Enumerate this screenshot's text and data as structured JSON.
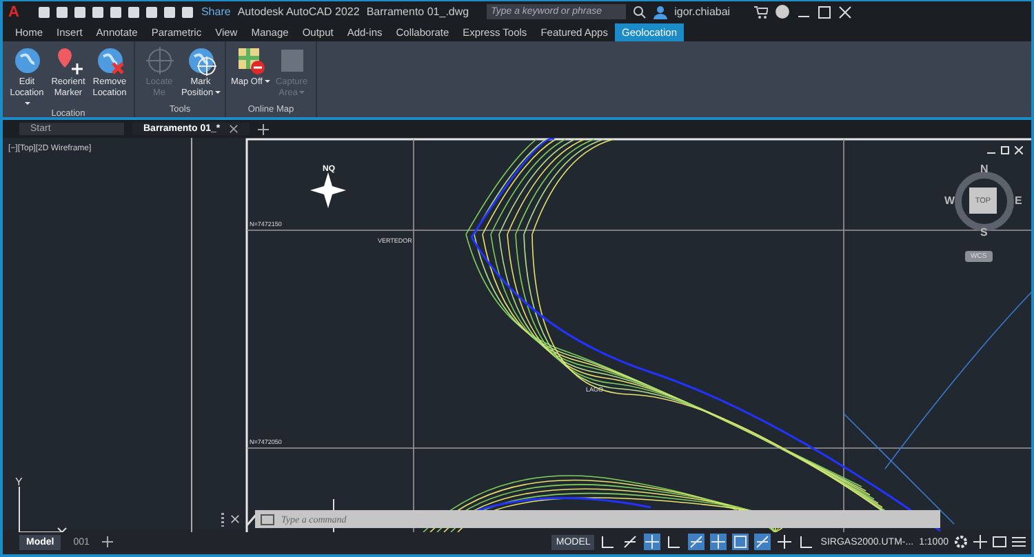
{
  "title_bar": {
    "logo": "A",
    "title": "Autodesk AutoCAD 2022",
    "file": "Barramento 01_.dwg",
    "share": "Share",
    "search": {
      "placeholder": "Type a keyword or phrase"
    },
    "user": "igor.chiabai"
  },
  "ribbon_tabs": [
    {
      "label": "Home",
      "selected": false
    },
    {
      "label": "Insert",
      "selected": false
    },
    {
      "label": "Annotate",
      "selected": false
    },
    {
      "label": "Parametric",
      "selected": false
    },
    {
      "label": "View",
      "selected": false
    },
    {
      "label": "Manage",
      "selected": false
    },
    {
      "label": "Output",
      "selected": false
    },
    {
      "label": "Add-ins",
      "selected": false
    },
    {
      "label": "Collaborate",
      "selected": false
    },
    {
      "label": "Express Tools",
      "selected": false
    },
    {
      "label": "Featured Apps",
      "selected": false
    },
    {
      "label": "Geolocation",
      "selected": true
    }
  ],
  "ribbon_panels": [
    {
      "title": "Location",
      "tools": [
        {
          "kind": "globe",
          "label": "Edit Location",
          "disabled": false,
          "dropdown": true
        },
        {
          "kind": "marker",
          "label": "Reorient Marker",
          "disabled": false,
          "dropdown": false
        },
        {
          "kind": "remove",
          "label": "Remove Location",
          "disabled": false,
          "dropdown": false
        }
      ]
    },
    {
      "title": "Tools",
      "tools": [
        {
          "kind": "locate",
          "label": "Locate Me",
          "disabled": true,
          "dropdown": false
        },
        {
          "kind": "mark",
          "label": "Mark Position",
          "disabled": false,
          "dropdown": true
        }
      ]
    },
    {
      "title": "Online Map",
      "tools": [
        {
          "kind": "map",
          "label": "Map Off",
          "disabled": false,
          "dropdown": true
        },
        {
          "kind": "capture",
          "label": "Capture Area",
          "disabled": true,
          "dropdown": true
        }
      ]
    }
  ],
  "file_tabs": [
    {
      "label": "Start",
      "selected": false
    },
    {
      "label": "Barramento 01_*",
      "selected": true
    }
  ],
  "viewport_label": "[−][Top][2D Wireframe]",
  "viewcube": {
    "north": "N",
    "south": "S",
    "east": "E",
    "west": "W",
    "face": "TOP",
    "ucs": "WCS"
  },
  "map_labels": [
    {
      "text": "NQ",
      "kind": "compass"
    },
    {
      "text": "N=7472150",
      "kind": "grid"
    },
    {
      "text": "VERTEDOR",
      "kind": "site"
    },
    {
      "text": "LAGO",
      "kind": "site"
    },
    {
      "text": "N=7472050",
      "kind": "grid"
    }
  ],
  "ucs_label": "Y",
  "command_line": {
    "placeholder": "Type a command"
  },
  "layout_tabs": [
    {
      "label": "Model",
      "selected": true
    },
    {
      "label": "001",
      "selected": false
    }
  ],
  "status_bar": {
    "space": "MODEL",
    "coordinate_system": "SIRGAS2000.UTM-...",
    "scale": "1:1000",
    "toggles": [
      {
        "kind": "grid",
        "on": false
      },
      {
        "kind": "ortho",
        "on": false
      },
      {
        "kind": "polar",
        "on": true
      },
      {
        "kind": "isodraft",
        "on": false
      },
      {
        "kind": "snap",
        "on": true
      },
      {
        "kind": "osnap",
        "on": true
      },
      {
        "kind": "geo",
        "on": true
      },
      {
        "kind": "annot",
        "on": true
      },
      {
        "kind": "annot2",
        "on": false
      },
      {
        "kind": "annot3",
        "on": false
      }
    ]
  }
}
